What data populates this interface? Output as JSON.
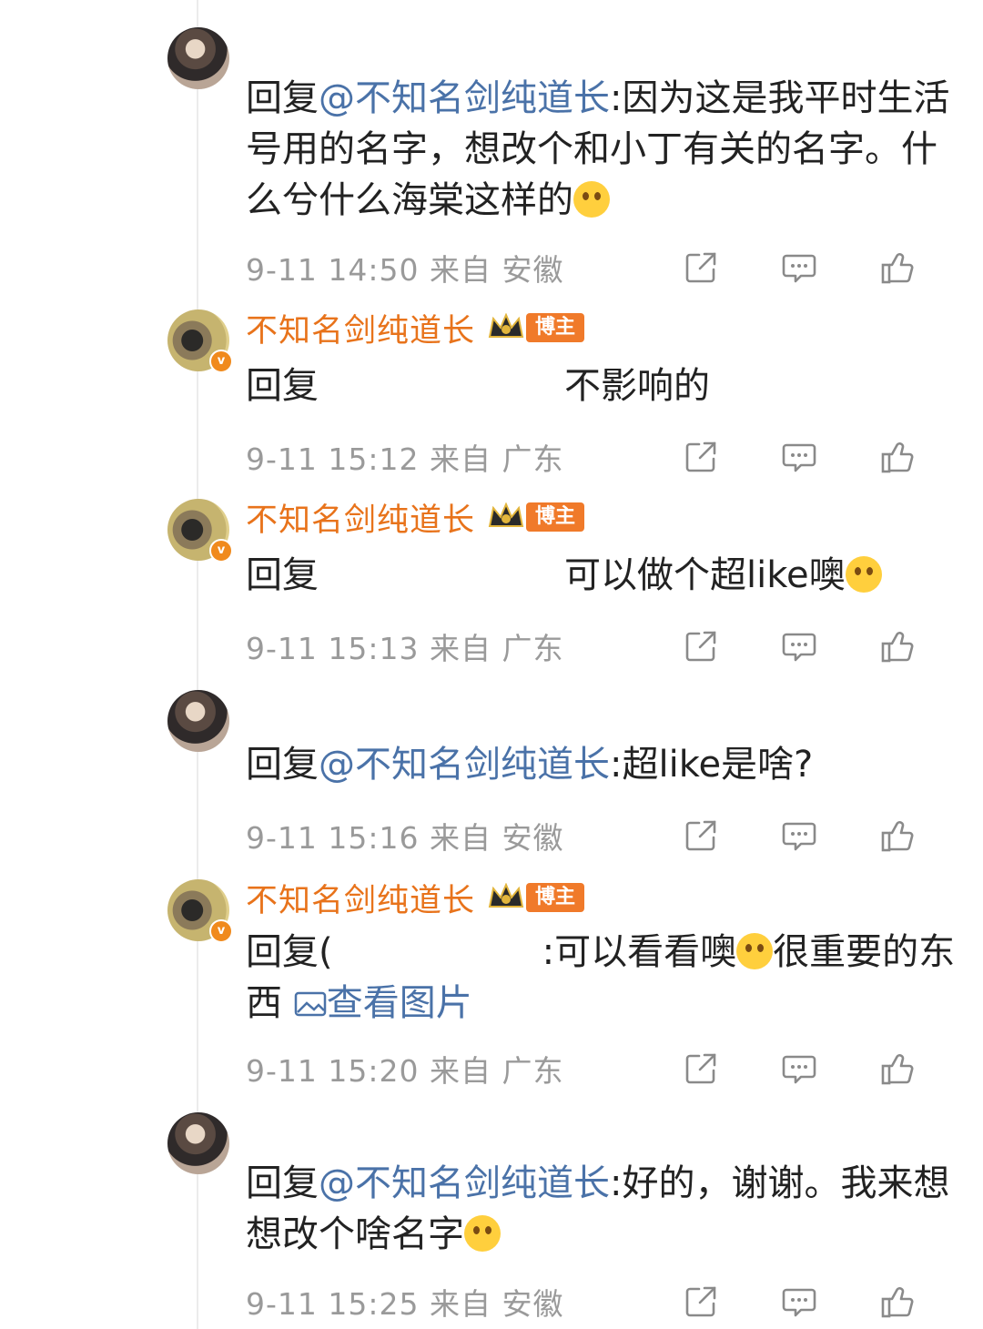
{
  "comments": [
    {
      "author_type": "fan",
      "reply_prefix": "回复",
      "mention": "@不知名剑纯道长",
      "text": ":因为这是我平时生活号用的名字，想改个和小丁有关的名字。什么兮什么海棠这样的",
      "emoji": "laugh-cry-emoji",
      "time": "9-11 14:50",
      "from": "来自 安徽"
    },
    {
      "author_type": "host",
      "author_name": "不知名剑纯道长",
      "host_tag": "博主",
      "reply_prefix": "回复",
      "text": "不影响的",
      "time": "9-11 15:12",
      "from": "来自 广东"
    },
    {
      "author_type": "host",
      "author_name": "不知名剑纯道长",
      "host_tag": "博主",
      "reply_prefix": "回复",
      "text": "可以做个超like噢",
      "emoji": "pleading-emoji",
      "time": "9-11 15:13",
      "from": "来自 广东"
    },
    {
      "author_type": "fan",
      "reply_prefix": "回复",
      "mention": "@不知名剑纯道长",
      "text": ":超like是啥?",
      "time": "9-11 15:16",
      "from": "来自 安徽"
    },
    {
      "author_type": "host",
      "author_name": "不知名剑纯道长",
      "host_tag": "博主",
      "reply_prefix": "回复(",
      "text": ":可以看看噢",
      "text2": "很重要的东西",
      "emoji": "crying-happy-emoji",
      "view_image": "查看图片",
      "time": "9-11 15:20",
      "from": "来自 广东"
    },
    {
      "author_type": "fan",
      "reply_prefix": "回复",
      "mention": "@不知名剑纯道长",
      "text": ":好的，谢谢。我来想想改个啥名字",
      "emoji": "grin-emoji",
      "time": "9-11 15:25",
      "from": "来自 安徽"
    }
  ],
  "colors": {
    "author": "#e8731b",
    "mention": "#4a72a8",
    "meta": "#9a9a9a",
    "host_tag_bg": "#f07a2a"
  }
}
